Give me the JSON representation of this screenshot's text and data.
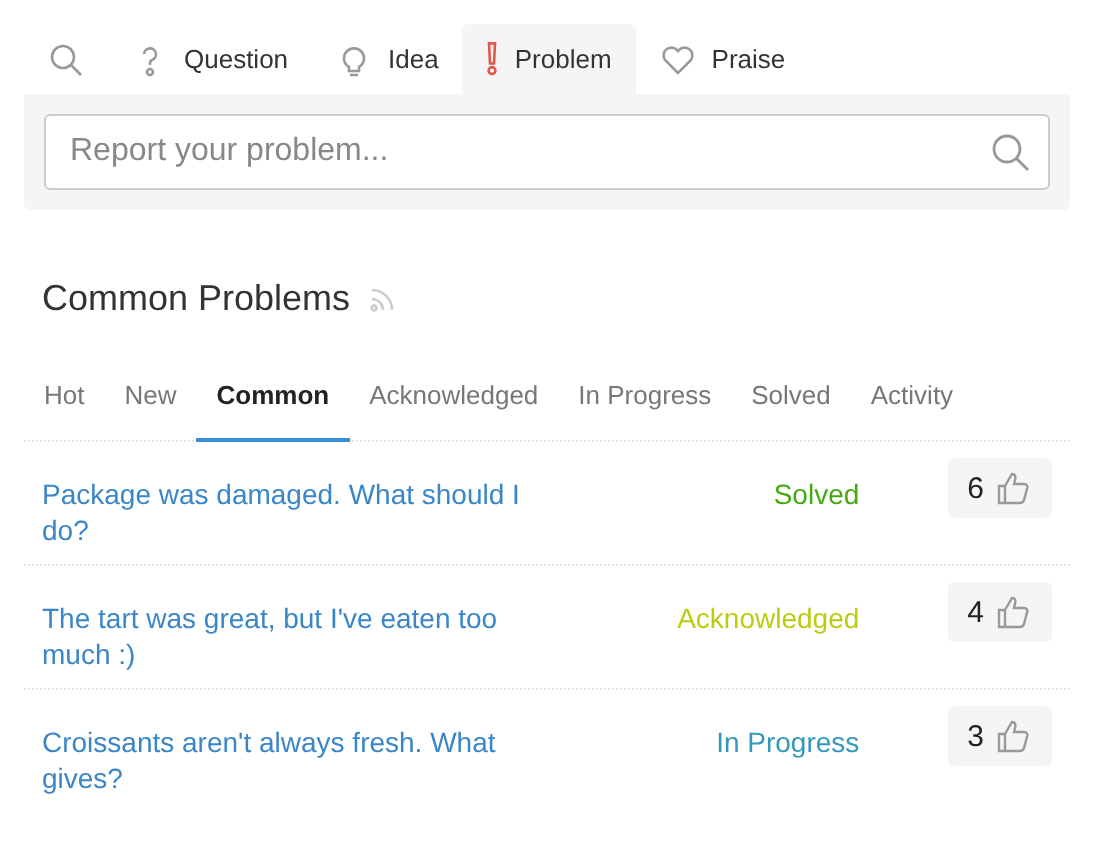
{
  "type_tabs": [
    {
      "kind": "search",
      "selected": false
    },
    {
      "kind": "question",
      "label": "Question",
      "selected": false
    },
    {
      "kind": "idea",
      "label": "Idea",
      "selected": false
    },
    {
      "kind": "problem",
      "label": "Problem",
      "selected": true
    },
    {
      "kind": "praise",
      "label": "Praise",
      "selected": false
    }
  ],
  "search": {
    "placeholder": "Report your problem..."
  },
  "section": {
    "title": "Common Problems"
  },
  "filter_tabs": [
    {
      "label": "Hot",
      "selected": false
    },
    {
      "label": "New",
      "selected": false
    },
    {
      "label": "Common",
      "selected": true
    },
    {
      "label": "Acknowledged",
      "selected": false
    },
    {
      "label": "In Progress",
      "selected": false
    },
    {
      "label": "Solved",
      "selected": false
    },
    {
      "label": "Activity",
      "selected": false
    }
  ],
  "topics": [
    {
      "title": "Package was damaged. What should I do?",
      "status": "Solved",
      "color": "#44aa11",
      "votes": "6"
    },
    {
      "title": "The tart was great, but I've eaten too much :)",
      "status": "Acknowledged",
      "color": "#bbcc11",
      "votes": "4"
    },
    {
      "title": "Croissants aren't always fresh. What gives?",
      "status": "In Progress",
      "color": "#3399bb",
      "votes": "3"
    }
  ]
}
